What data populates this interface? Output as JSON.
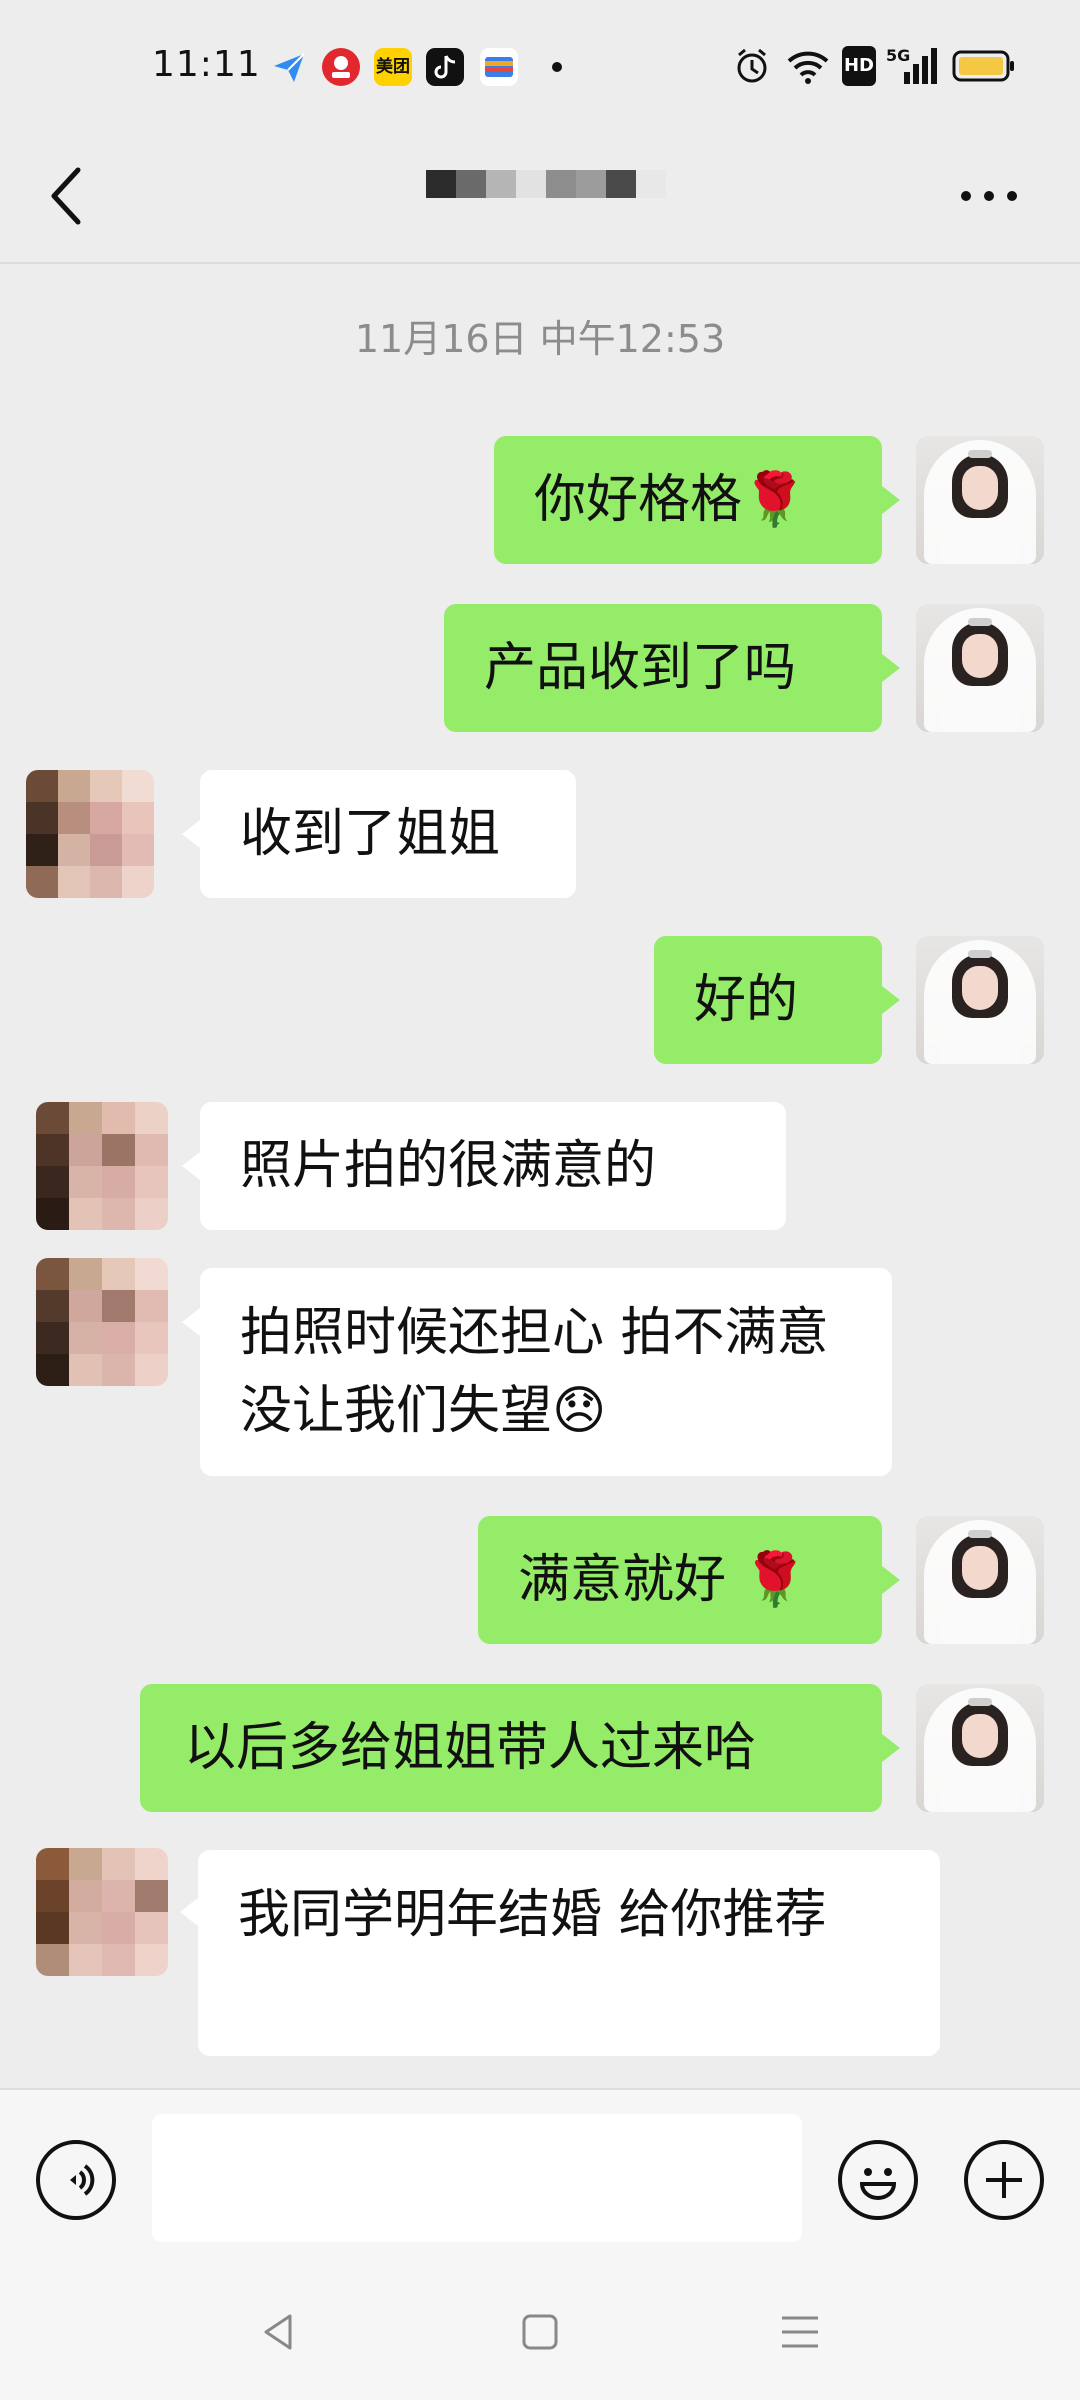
{
  "status_bar": {
    "time": "11:11",
    "app_icons": [
      "feishu-icon",
      "pinduoduo-icon",
      "meituan-icon",
      "douyin-icon",
      "wallet-icon"
    ],
    "meituan_label": "美团",
    "right_icons": [
      "alarm-icon",
      "wifi-icon",
      "hd-icon",
      "5g-signal-icon",
      "battery-icon"
    ],
    "hd_label": "HD",
    "network_label": "5G"
  },
  "header": {
    "back_icon": "chevron-left-icon",
    "title": "",
    "more_icon": "more-horizontal-icon"
  },
  "chat": {
    "timestamp": "11月16日 中午12:53",
    "messages": [
      {
        "side": "right",
        "text": "你好格格🌹"
      },
      {
        "side": "right",
        "text": "产品收到了吗"
      },
      {
        "side": "left",
        "text": "收到了姐姐"
      },
      {
        "side": "right",
        "text": "好的"
      },
      {
        "side": "left",
        "text": "照片拍的很满意的"
      },
      {
        "side": "left",
        "text": "拍照时候还担心 拍不满意   没让我们失望😞"
      },
      {
        "side": "right",
        "text": "满意就好 🌹"
      },
      {
        "side": "right",
        "text": "以后多给姐姐带人过来哈"
      },
      {
        "side": "left",
        "text": "我同学明年结婚   给你推荐"
      }
    ]
  },
  "input_bar": {
    "voice_icon": "voice-icon",
    "emoji_icon": "emoji-icon",
    "plus_icon": "plus-icon",
    "text_value": ""
  },
  "nav_bar": {
    "back_icon": "nav-back-icon",
    "home_icon": "nav-home-icon",
    "menu_icon": "nav-menu-icon"
  },
  "colors": {
    "background": "#ededed",
    "sent_bubble": "#95ec69",
    "received_bubble": "#ffffff",
    "timestamp_text": "#8c8c8c"
  }
}
